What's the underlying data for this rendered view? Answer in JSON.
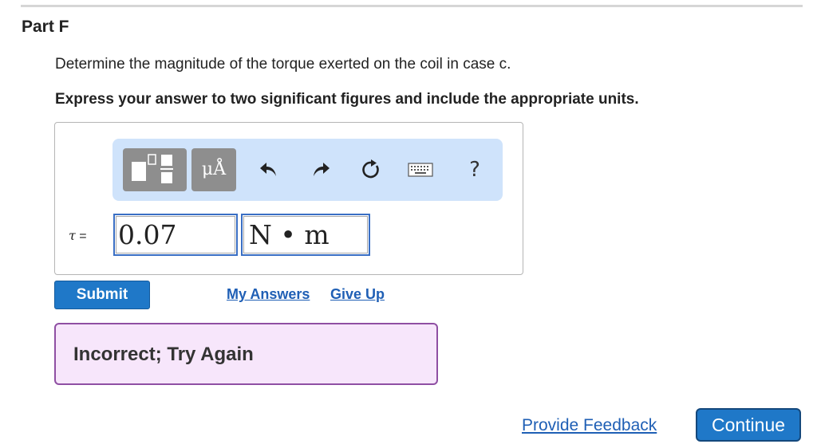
{
  "part": {
    "title": "Part F"
  },
  "question": {
    "prompt": "Determine the magnitude of the torque exerted on the coil in case c.",
    "instruction": "Express your answer to two significant figures and include the appropriate units."
  },
  "toolbar": {
    "units_label": "μÅ",
    "help_label": "?",
    "icons": [
      "templates-icon",
      "units-icon",
      "undo-icon",
      "redo-icon",
      "reset-icon",
      "keyboard-icon",
      "help-icon"
    ]
  },
  "answer": {
    "variable_symbol": "τ",
    "equals": " =",
    "value": "0.07",
    "units": "N • m"
  },
  "actions": {
    "submit_label": "Submit",
    "my_answers_label": "My Answers",
    "give_up_label": "Give Up"
  },
  "feedback": {
    "message": "Incorrect; Try Again"
  },
  "footer": {
    "provide_feedback_label": "Provide Feedback",
    "continue_label": "Continue"
  },
  "colors": {
    "primary_button": "#1f78c8",
    "link": "#1f5fb5",
    "toolbar_bg": "#cfe3fb",
    "feedback_bg": "#f7e6fb",
    "feedback_border": "#8f4fa3"
  }
}
